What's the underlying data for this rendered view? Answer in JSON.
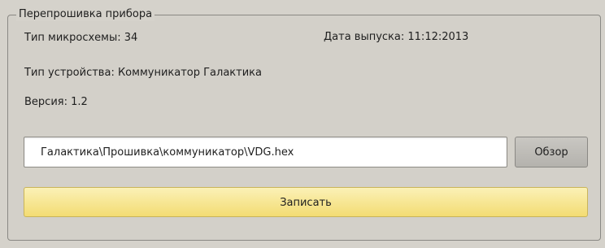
{
  "group": {
    "title": "Перепрошивка прибора"
  },
  "info": {
    "chip_type": "Тип микросхемы: 34",
    "release_date": "Дата выпуска: 11:12:2013",
    "device_type": "Тип устройства: Коммуникатор Галактика",
    "version": "Версия: 1.2"
  },
  "file": {
    "path_value": "Галактика\\Прошивка\\коммуникатор\\VDG.hex",
    "browse_label": "Обзор"
  },
  "actions": {
    "write_label": "Записать"
  },
  "colors": {
    "background": "#d5d2cb",
    "write_button": "#f3dc73"
  }
}
